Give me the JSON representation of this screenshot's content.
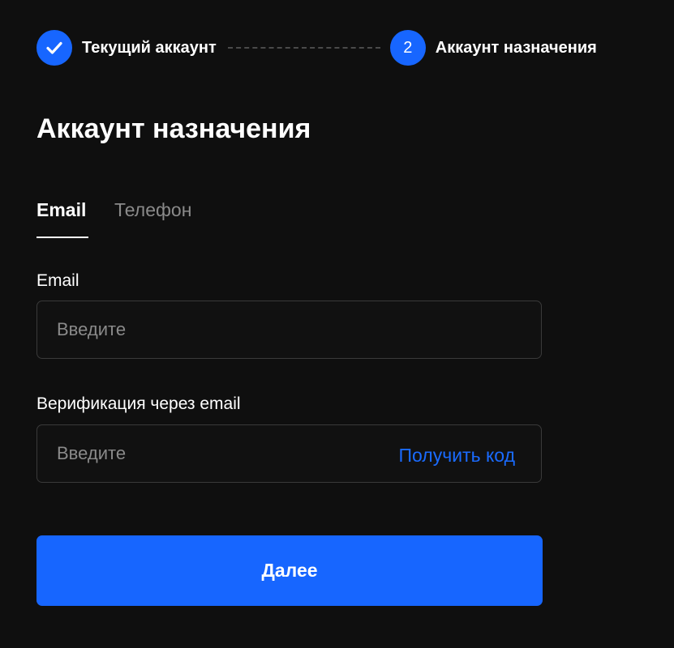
{
  "stepper": {
    "step1": {
      "label": "Текущий аккаунт",
      "icon": "check-icon",
      "state": "completed"
    },
    "step2": {
      "number": "2",
      "label": "Аккаунт назначения",
      "state": "current"
    },
    "accent_color": "#1766ff"
  },
  "page_title": "Аккаунт назначения",
  "tabs": [
    {
      "label": "Email",
      "active": true
    },
    {
      "label": "Телефон",
      "active": false
    }
  ],
  "form": {
    "email": {
      "label": "Email",
      "placeholder": "Введите",
      "value": ""
    },
    "verification": {
      "label": "Верификация через email",
      "placeholder": "Введите",
      "value": "",
      "get_code_label": "Получить код"
    }
  },
  "next_button_label": "Далее",
  "colors": {
    "background": "#0f0f0f",
    "primary": "#1766ff",
    "link": "#1a6bff",
    "muted_text": "#8a8a8a"
  }
}
